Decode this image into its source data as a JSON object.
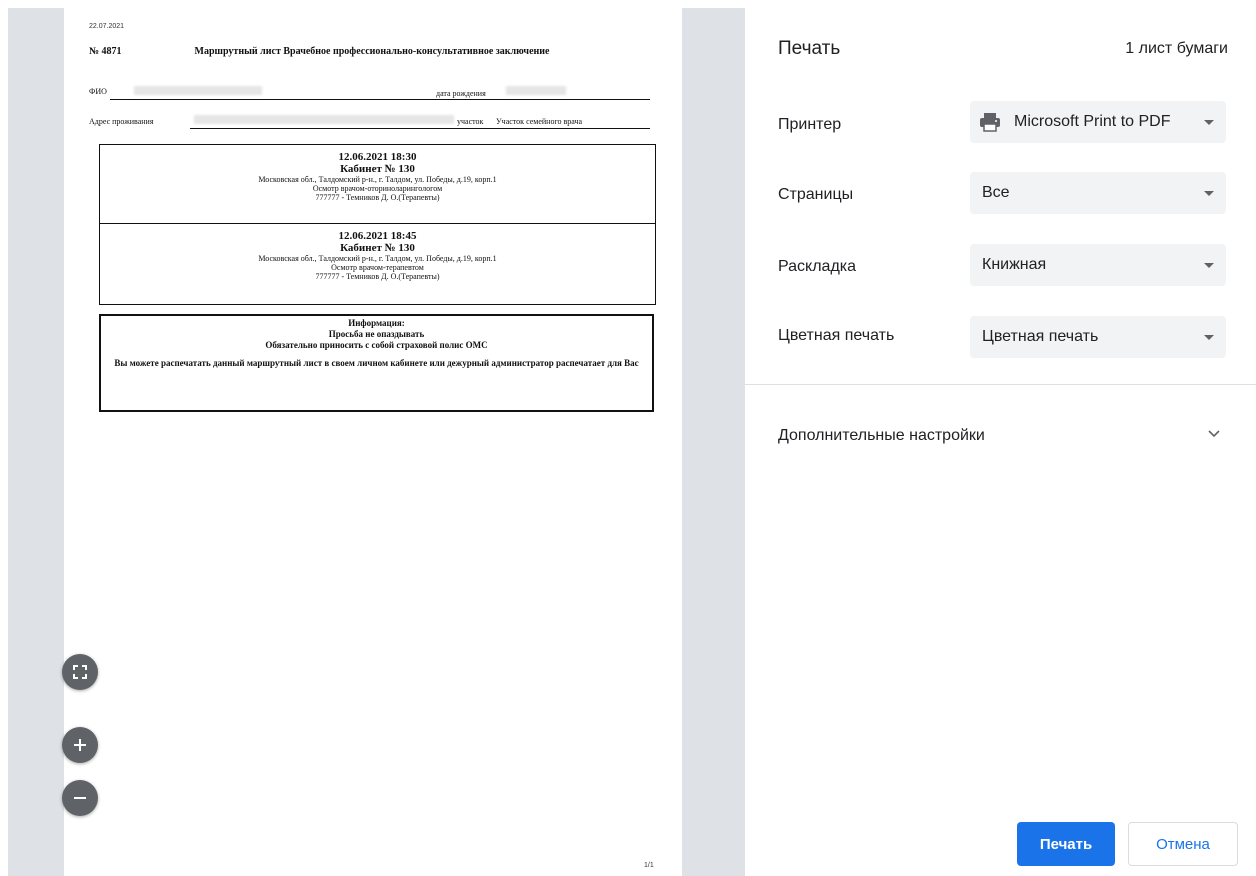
{
  "preview": {
    "date": "22.07.2021",
    "doc_number": "№ 4871",
    "doc_title": "Маршрутный лист Врачебное профессионально-консультативное заключение",
    "fio_label": "ФИО",
    "dob_label": "дата рождения",
    "address_label": "Адрес проживания",
    "district_label": "участок",
    "district_value": "Участок семейного врача",
    "appointments": [
      {
        "datetime": "12.06.2021 18:30",
        "cabinet": "Кабинет № 130",
        "address": "Московская обл., Талдомский р-н., г. Талдом, ул. Победы, д.19, корп.1",
        "service": "Осмотр врачом-оториноларингологом",
        "doctor": "777777 - Темников Д. О.(Терапевты)"
      },
      {
        "datetime": "12.06.2021 18:45",
        "cabinet": "Кабинет № 130",
        "address": "Московская обл., Талдомский р-н., г. Талдом, ул. Победы, д.19, корп.1",
        "service": "Осмотр врачом-терапевтом",
        "doctor": "777777 - Темников Д. О.(Терапевты)"
      }
    ],
    "info": {
      "title": "Информация:",
      "line1": "Просьба не опаздывать",
      "line2": "Обязательно приносить с собой страховой полис ОМС",
      "note": "Вы можете распечатать данный маршрутный лист в своем личном кабинете или дежурный администратор распечатает для Вас"
    },
    "page_indicator": "1/1"
  },
  "zoom_controls": {
    "fit_icon": "fit-to-page-icon",
    "zoom_in_icon": "plus-icon",
    "zoom_out_icon": "minus-icon"
  },
  "settings": {
    "title": "Печать",
    "sheet_count": "1 лист бумаги",
    "printer": {
      "label": "Принтер",
      "value": "Microsoft Print to PDF",
      "icon": "printer-icon"
    },
    "pages": {
      "label": "Страницы",
      "value": "Все"
    },
    "layout": {
      "label": "Раскладка",
      "value": "Книжная"
    },
    "color": {
      "label": "Цветная печать",
      "value": "Цветная печать"
    },
    "more_settings": {
      "label": "Дополнительные настройки",
      "icon": "chevron-down-icon"
    },
    "print_label": "Печать",
    "cancel_label": "Отмена"
  },
  "colors": {
    "accent": "#1a73e8",
    "preview_background": "#dee1e6",
    "select_background": "#f1f3f4",
    "text": "#202124",
    "zoom_button": "#5f6368"
  }
}
